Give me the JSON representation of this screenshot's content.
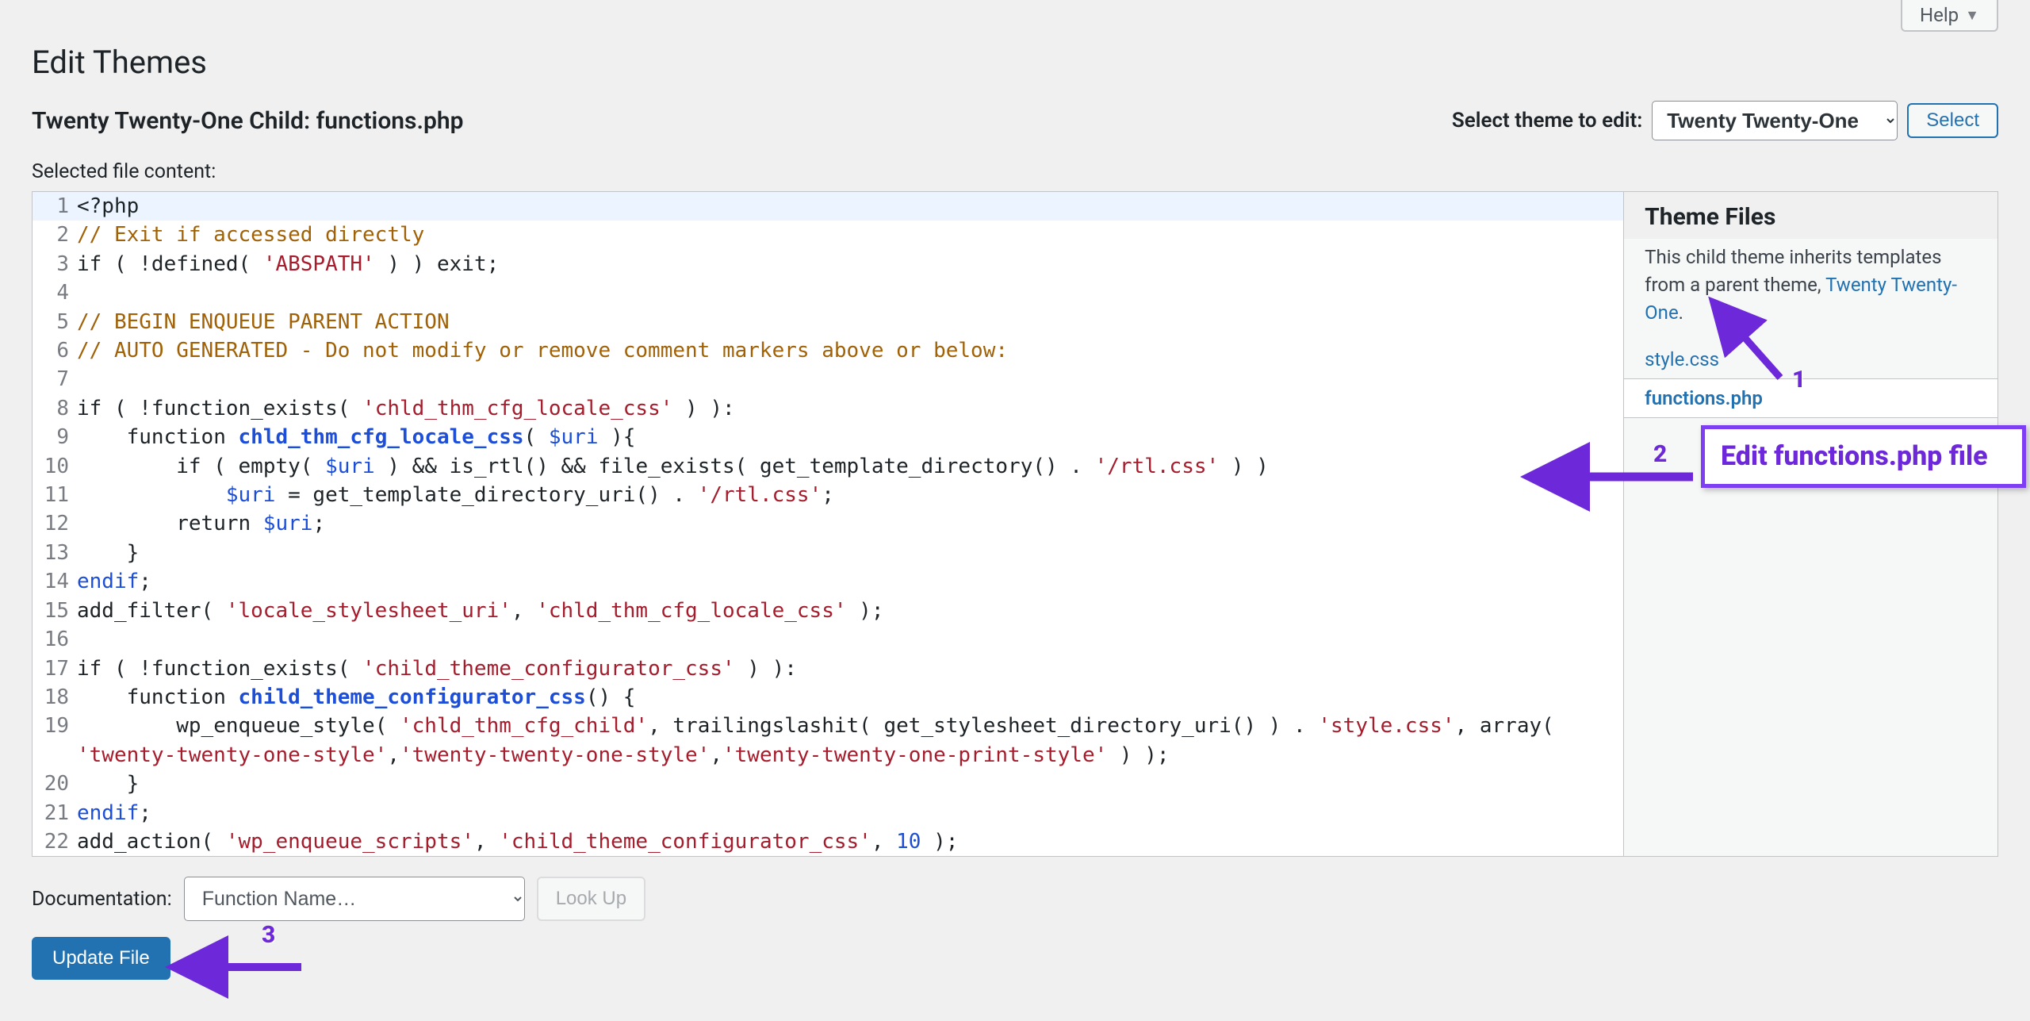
{
  "help": {
    "label": "Help"
  },
  "page_title": "Edit Themes",
  "file_heading": "Twenty Twenty-One Child: functions.php",
  "theme_selector": {
    "label": "Select theme to edit:",
    "selected": "Twenty Twenty-One",
    "select_button": "Select"
  },
  "content_label": "Selected file content:",
  "code_lines": [
    {
      "n": 1,
      "html": "<span class='c-kw'>&lt;?php</span>",
      "hl": true
    },
    {
      "n": 2,
      "html": "<span class='c-cm'>// Exit if accessed directly</span>"
    },
    {
      "n": 3,
      "html": "<span class='c-kw'>if</span> ( !defined( <span class='c-st'>'ABSPATH'</span> ) ) <span class='c-kw'>exit</span>;"
    },
    {
      "n": 4,
      "html": ""
    },
    {
      "n": 5,
      "html": "<span class='c-cm'>// BEGIN ENQUEUE PARENT ACTION</span>"
    },
    {
      "n": 6,
      "html": "<span class='c-cm'>// AUTO GENERATED - Do not modify or remove comment markers above or below:</span>"
    },
    {
      "n": 7,
      "html": ""
    },
    {
      "n": 8,
      "html": "<span class='c-kw'>if</span> ( !function_exists( <span class='c-st'>'chld_thm_cfg_locale_css'</span> ) ):"
    },
    {
      "n": 9,
      "html": "    <span class='c-kw'>function</span> <span class='c-def'>chld_thm_cfg_locale_css</span>( <span class='c-vr'>$uri</span> ){"
    },
    {
      "n": 10,
      "html": "        <span class='c-kw'>if</span> ( empty( <span class='c-vr'>$uri</span> ) &amp;&amp; is_rtl() &amp;&amp; file_exists( get_template_directory() . <span class='c-st'>'/rtl.css'</span> ) )"
    },
    {
      "n": 11,
      "html": "            <span class='c-vr'>$uri</span> = get_template_directory_uri() . <span class='c-st'>'/rtl.css'</span>;"
    },
    {
      "n": 12,
      "html": "        <span class='c-kw'>return</span> <span class='c-vr'>$uri</span>;"
    },
    {
      "n": 13,
      "html": "    }"
    },
    {
      "n": 14,
      "html": "<span class='c-wd'>endif</span>;"
    },
    {
      "n": 15,
      "html": "add_filter( <span class='c-st'>'locale_stylesheet_uri'</span>, <span class='c-st'>'chld_thm_cfg_locale_css'</span> );"
    },
    {
      "n": 16,
      "html": ""
    },
    {
      "n": 17,
      "html": "<span class='c-kw'>if</span> ( !function_exists( <span class='c-st'>'child_theme_configurator_css'</span> ) ):"
    },
    {
      "n": 18,
      "html": "    <span class='c-kw'>function</span> <span class='c-def'>child_theme_configurator_css</span>() {"
    },
    {
      "n": 19,
      "html": "        wp_enqueue_style( <span class='c-st'>'chld_thm_cfg_child'</span>, trailingslashit( get_stylesheet_directory_uri() ) . <span class='c-st'>'style.css'</span>, <span class='c-kw'>array</span>( <span class='c-st'>'twenty-twenty-one-style'</span>,<span class='c-st'>'twenty-twenty-one-style'</span>,<span class='c-st'>'twenty-twenty-one-print-style'</span> ) );",
      "wrap": true
    },
    {
      "n": 20,
      "html": "    }"
    },
    {
      "n": 21,
      "html": "<span class='c-wd'>endif</span>;"
    },
    {
      "n": 22,
      "html": "add_action( <span class='c-st'>'wp_enqueue_scripts'</span>, <span class='c-st'>'child_theme_configurator_css'</span>, <span class='c-nm'>10</span> );"
    }
  ],
  "sidebar": {
    "heading": "Theme Files",
    "note_prefix": "This child theme inherits templates from a parent theme, ",
    "parent_link": "Twenty Twenty-One",
    "files": [
      {
        "name": "style.css",
        "active": false
      },
      {
        "name": "functions.php",
        "active": true
      }
    ]
  },
  "documentation": {
    "label": "Documentation:",
    "placeholder": "Function Name…",
    "lookup": "Look Up"
  },
  "update_button": "Update File",
  "annotations": {
    "n1": "1",
    "n2": "2",
    "n3": "3",
    "callout": "Edit functions.php file"
  }
}
